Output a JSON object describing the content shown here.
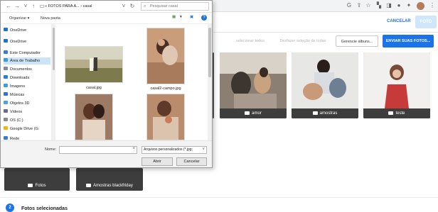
{
  "browser": {
    "icons": [
      "google-icon",
      "share-icon",
      "star-icon",
      "extension-icon",
      "extension-icon",
      "extension-icon",
      "puzzle-icon",
      "profile-avatar",
      "menu-icon"
    ]
  },
  "app": {
    "cancel_label": "CANCELAR",
    "foto_label": "FOTO",
    "toolbar": {
      "select_all": "selecionar todos",
      "undo_select": "Desfazer seleção de todas",
      "manage_albums": "Gerencie álbuns...",
      "send_photos": "ENVIAR SUAS FOTOS..."
    },
    "folders": [
      {
        "label": ""
      },
      {
        "label": "amor"
      },
      {
        "label": "amostras"
      },
      {
        "label": "teste"
      }
    ],
    "bottom_folders": [
      {
        "label": "Fotos"
      },
      {
        "label": "Amostras blackfriday"
      }
    ],
    "step": {
      "number": "2",
      "title": "Fotos selecionadas"
    }
  },
  "dialog": {
    "breadcrumb": "« FOTOS PARA A... › casal",
    "search_placeholder": "Pesquisar casal",
    "organize": "Organizar ▾",
    "new_folder": "Nova pasta",
    "nav": [
      {
        "label": "OneDrive",
        "color": "#1e73d2"
      },
      {
        "label": "OneDrive",
        "color": "#1e73d2"
      },
      {
        "label": "Este Computador",
        "color": "#3a7bd5"
      },
      {
        "label": "Área de Trabalho",
        "color": "#3a9ad9",
        "selected": true
      },
      {
        "label": "Documentos",
        "color": "#7d8da0"
      },
      {
        "label": "Downloads",
        "color": "#2d7bd8"
      },
      {
        "label": "Imagens",
        "color": "#3aa0d8"
      },
      {
        "label": "Músicas",
        "color": "#2f6fd6"
      },
      {
        "label": "Objetos 3D",
        "color": "#4aa3e0"
      },
      {
        "label": "Vídeos",
        "color": "#6a6a8a"
      },
      {
        "label": "OS (C:)",
        "color": "#8a8a8a"
      },
      {
        "label": "Google Drive (G:",
        "color": "#f4b400"
      },
      {
        "label": "Rede",
        "color": "#3a7bd5"
      }
    ],
    "files": [
      {
        "name": "casal.jpg"
      },
      {
        "name": "casal2-campo.jpg"
      },
      {
        "name": ""
      },
      {
        "name": ""
      }
    ],
    "name_label": "Nome:",
    "file_type": "Arquivos personalizados (*.jpg;",
    "open_label": "Abrir",
    "cancel_label": "Cancelar"
  }
}
